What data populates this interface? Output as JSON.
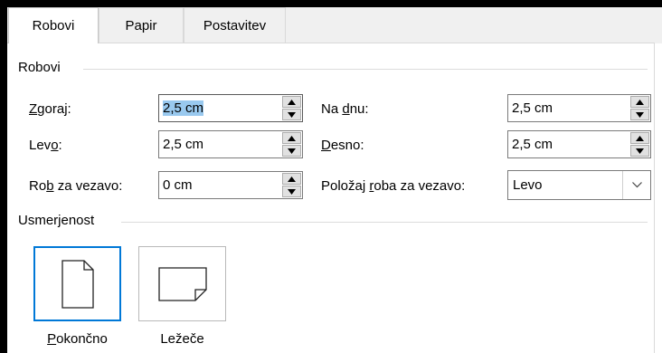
{
  "tabs": [
    {
      "label": "Robovi",
      "active": true
    },
    {
      "label": "Papir",
      "active": false
    },
    {
      "label": "Postavitev",
      "active": false
    }
  ],
  "margins_group": {
    "title": "Robovi",
    "top": {
      "label_pre": "",
      "label_u": "Z",
      "label_post": "goraj:",
      "value": "2,5 cm"
    },
    "bottom": {
      "label_pre": "Na ",
      "label_u": "d",
      "label_post": "nu:",
      "value": "2,5 cm"
    },
    "left": {
      "label_pre": "Lev",
      "label_u": "o",
      "label_post": ":",
      "value": "2,5 cm"
    },
    "right": {
      "label_pre": "",
      "label_u": "D",
      "label_post": "esno:",
      "value": "2,5 cm"
    },
    "gutter": {
      "label_pre": "Ro",
      "label_u": "b",
      "label_post": " za vezavo:",
      "value": "0 cm"
    },
    "gutter_position": {
      "label_pre": "Položaj ",
      "label_u": "r",
      "label_post": "oba za vezavo:",
      "value": "Levo"
    }
  },
  "orientation_group": {
    "title": "Usmerjenost",
    "portrait": {
      "label_u": "P",
      "label_post": "okončno",
      "selected": true
    },
    "landscape": {
      "label_u": "",
      "label_post": "Ležeče",
      "selected": false
    }
  },
  "icons": [
    "spin-up-icon",
    "spin-down-icon",
    "chevron-down-icon",
    "portrait-page-icon",
    "landscape-page-icon"
  ],
  "colors": {
    "selection": "#99c9ef",
    "focus_border": "#0078d7"
  }
}
